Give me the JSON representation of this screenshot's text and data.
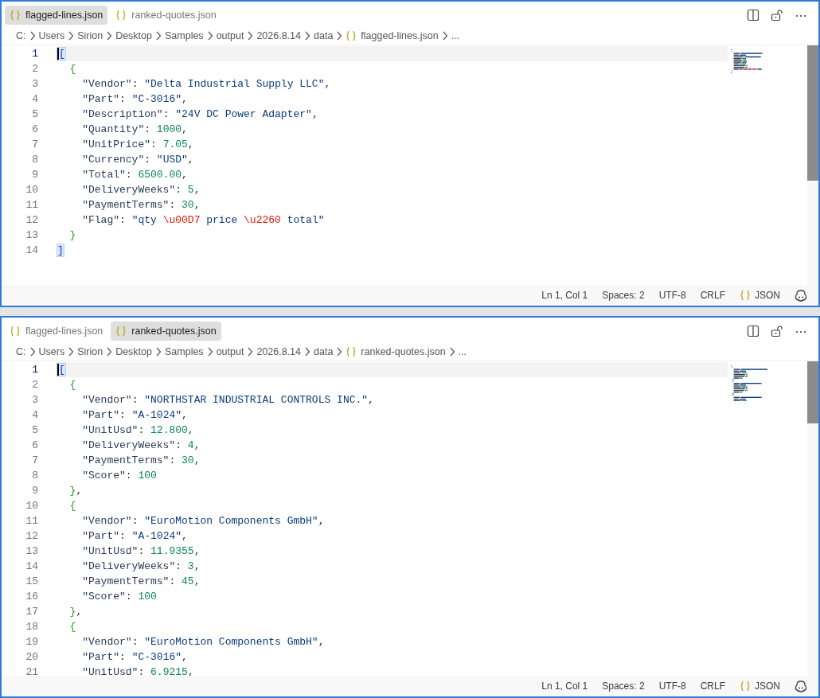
{
  "panes": [
    {
      "tabs": [
        {
          "label": "flagged-lines.json",
          "selected": true
        },
        {
          "label": "ranked-quotes.json",
          "selected": false
        }
      ],
      "breadcrumb": [
        "C:",
        "Users",
        "Sirion",
        "Desktop",
        "Samples",
        "output",
        "2026.8.14",
        "data",
        "flagged-lines.json",
        "..."
      ],
      "lines": [
        {
          "no": "1",
          "current": true,
          "tokens": [
            {
              "kind": "match",
              "text": "["
            }
          ]
        },
        {
          "no": "2",
          "current": false,
          "tokens": [
            {
              "kind": "brace",
              "text": "  {"
            }
          ]
        },
        {
          "no": "3",
          "current": false,
          "tokens": [
            {
              "kind": "key",
              "text": "    \"Vendor\""
            },
            {
              "kind": "p",
              "text": ": "
            },
            {
              "kind": "str",
              "text": "\"Delta Industrial Supply LLC\""
            },
            {
              "kind": "p",
              "text": ","
            }
          ]
        },
        {
          "no": "4",
          "current": false,
          "tokens": [
            {
              "kind": "key",
              "text": "    \"Part\""
            },
            {
              "kind": "p",
              "text": ": "
            },
            {
              "kind": "str",
              "text": "\"C-3016\""
            },
            {
              "kind": "p",
              "text": ","
            }
          ]
        },
        {
          "no": "5",
          "current": false,
          "tokens": [
            {
              "kind": "key",
              "text": "    \"Description\""
            },
            {
              "kind": "p",
              "text": ": "
            },
            {
              "kind": "str",
              "text": "\"24V DC Power Adapter\""
            },
            {
              "kind": "p",
              "text": ","
            }
          ]
        },
        {
          "no": "6",
          "current": false,
          "tokens": [
            {
              "kind": "key",
              "text": "    \"Quantity\""
            },
            {
              "kind": "p",
              "text": ": "
            },
            {
              "kind": "num",
              "text": "1000"
            },
            {
              "kind": "p",
              "text": ","
            }
          ]
        },
        {
          "no": "7",
          "current": false,
          "tokens": [
            {
              "kind": "key",
              "text": "    \"UnitPrice\""
            },
            {
              "kind": "p",
              "text": ": "
            },
            {
              "kind": "num",
              "text": "7.05"
            },
            {
              "kind": "p",
              "text": ","
            }
          ]
        },
        {
          "no": "8",
          "current": false,
          "tokens": [
            {
              "kind": "key",
              "text": "    \"Currency\""
            },
            {
              "kind": "p",
              "text": ": "
            },
            {
              "kind": "str",
              "text": "\"USD\""
            },
            {
              "kind": "p",
              "text": ","
            }
          ]
        },
        {
          "no": "9",
          "current": false,
          "tokens": [
            {
              "kind": "key",
              "text": "    \"Total\""
            },
            {
              "kind": "p",
              "text": ": "
            },
            {
              "kind": "num",
              "text": "6500.00"
            },
            {
              "kind": "p",
              "text": ","
            }
          ]
        },
        {
          "no": "10",
          "current": false,
          "tokens": [
            {
              "kind": "key",
              "text": "    \"DeliveryWeeks\""
            },
            {
              "kind": "p",
              "text": ": "
            },
            {
              "kind": "num",
              "text": "5"
            },
            {
              "kind": "p",
              "text": ","
            }
          ]
        },
        {
          "no": "11",
          "current": false,
          "tokens": [
            {
              "kind": "key",
              "text": "    \"PaymentTerms\""
            },
            {
              "kind": "p",
              "text": ": "
            },
            {
              "kind": "num",
              "text": "30"
            },
            {
              "kind": "p",
              "text": ","
            }
          ]
        },
        {
          "no": "12",
          "current": false,
          "tokens": [
            {
              "kind": "key",
              "text": "    \"Flag\""
            },
            {
              "kind": "p",
              "text": ": "
            },
            {
              "kind": "str",
              "text": "\"qty "
            },
            {
              "kind": "esc",
              "text": "\\u00D7"
            },
            {
              "kind": "str",
              "text": " price "
            },
            {
              "kind": "esc",
              "text": "\\u2260"
            },
            {
              "kind": "str",
              "text": " total\""
            }
          ]
        },
        {
          "no": "13",
          "current": false,
          "tokens": [
            {
              "kind": "brace",
              "text": "  }"
            }
          ]
        },
        {
          "no": "14",
          "current": false,
          "tokens": [
            {
              "kind": "match",
              "text": "]"
            }
          ]
        }
      ],
      "status": [
        "Ln 1, Col 1",
        "Spaces: 2",
        "UTF-8",
        "CRLF",
        "JSON"
      ]
    },
    {
      "tabs": [
        {
          "label": "flagged-lines.json",
          "selected": false
        },
        {
          "label": "ranked-quotes.json",
          "selected": true
        }
      ],
      "breadcrumb": [
        "C:",
        "Users",
        "Sirion",
        "Desktop",
        "Samples",
        "output",
        "2026.8.14",
        "data",
        "ranked-quotes.json",
        "..."
      ],
      "lines": [
        {
          "no": "1",
          "current": true,
          "tokens": [
            {
              "kind": "match",
              "text": "["
            }
          ]
        },
        {
          "no": "2",
          "current": false,
          "tokens": [
            {
              "kind": "brace",
              "text": "  {"
            }
          ]
        },
        {
          "no": "3",
          "current": false,
          "tokens": [
            {
              "kind": "key",
              "text": "    \"Vendor\""
            },
            {
              "kind": "p",
              "text": ": "
            },
            {
              "kind": "str",
              "text": "\"NORTHSTAR INDUSTRIAL CONTROLS INC.\""
            },
            {
              "kind": "p",
              "text": ","
            }
          ]
        },
        {
          "no": "4",
          "current": false,
          "tokens": [
            {
              "kind": "key",
              "text": "    \"Part\""
            },
            {
              "kind": "p",
              "text": ": "
            },
            {
              "kind": "str",
              "text": "\"A-1024\""
            },
            {
              "kind": "p",
              "text": ","
            }
          ]
        },
        {
          "no": "5",
          "current": false,
          "tokens": [
            {
              "kind": "key",
              "text": "    \"UnitUsd\""
            },
            {
              "kind": "p",
              "text": ": "
            },
            {
              "kind": "num",
              "text": "12.800"
            },
            {
              "kind": "p",
              "text": ","
            }
          ]
        },
        {
          "no": "6",
          "current": false,
          "tokens": [
            {
              "kind": "key",
              "text": "    \"DeliveryWeeks\""
            },
            {
              "kind": "p",
              "text": ": "
            },
            {
              "kind": "num",
              "text": "4"
            },
            {
              "kind": "p",
              "text": ","
            }
          ]
        },
        {
          "no": "7",
          "current": false,
          "tokens": [
            {
              "kind": "key",
              "text": "    \"PaymentTerms\""
            },
            {
              "kind": "p",
              "text": ": "
            },
            {
              "kind": "num",
              "text": "30"
            },
            {
              "kind": "p",
              "text": ","
            }
          ]
        },
        {
          "no": "8",
          "current": false,
          "tokens": [
            {
              "kind": "key",
              "text": "    \"Score\""
            },
            {
              "kind": "p",
              "text": ": "
            },
            {
              "kind": "num",
              "text": "100"
            }
          ]
        },
        {
          "no": "9",
          "current": false,
          "tokens": [
            {
              "kind": "brace",
              "text": "  }"
            },
            {
              "kind": "p",
              "text": ","
            }
          ]
        },
        {
          "no": "10",
          "current": false,
          "tokens": [
            {
              "kind": "brace",
              "text": "  {"
            }
          ]
        },
        {
          "no": "11",
          "current": false,
          "tokens": [
            {
              "kind": "key",
              "text": "    \"Vendor\""
            },
            {
              "kind": "p",
              "text": ": "
            },
            {
              "kind": "str",
              "text": "\"EuroMotion Components GmbH\""
            },
            {
              "kind": "p",
              "text": ","
            }
          ]
        },
        {
          "no": "12",
          "current": false,
          "tokens": [
            {
              "kind": "key",
              "text": "    \"Part\""
            },
            {
              "kind": "p",
              "text": ": "
            },
            {
              "kind": "str",
              "text": "\"A-1024\""
            },
            {
              "kind": "p",
              "text": ","
            }
          ]
        },
        {
          "no": "13",
          "current": false,
          "tokens": [
            {
              "kind": "key",
              "text": "    \"UnitUsd\""
            },
            {
              "kind": "p",
              "text": ": "
            },
            {
              "kind": "num",
              "text": "11.9355"
            },
            {
              "kind": "p",
              "text": ","
            }
          ]
        },
        {
          "no": "14",
          "current": false,
          "tokens": [
            {
              "kind": "key",
              "text": "    \"DeliveryWeeks\""
            },
            {
              "kind": "p",
              "text": ": "
            },
            {
              "kind": "num",
              "text": "3"
            },
            {
              "kind": "p",
              "text": ","
            }
          ]
        },
        {
          "no": "15",
          "current": false,
          "tokens": [
            {
              "kind": "key",
              "text": "    \"PaymentTerms\""
            },
            {
              "kind": "p",
              "text": ": "
            },
            {
              "kind": "num",
              "text": "45"
            },
            {
              "kind": "p",
              "text": ","
            }
          ]
        },
        {
          "no": "16",
          "current": false,
          "tokens": [
            {
              "kind": "key",
              "text": "    \"Score\""
            },
            {
              "kind": "p",
              "text": ": "
            },
            {
              "kind": "num",
              "text": "100"
            }
          ]
        },
        {
          "no": "17",
          "current": false,
          "tokens": [
            {
              "kind": "brace",
              "text": "  }"
            },
            {
              "kind": "p",
              "text": ","
            }
          ]
        },
        {
          "no": "18",
          "current": false,
          "tokens": [
            {
              "kind": "brace",
              "text": "  {"
            }
          ]
        },
        {
          "no": "19",
          "current": false,
          "tokens": [
            {
              "kind": "key",
              "text": "    \"Vendor\""
            },
            {
              "kind": "p",
              "text": ": "
            },
            {
              "kind": "str",
              "text": "\"EuroMotion Components GmbH\""
            },
            {
              "kind": "p",
              "text": ","
            }
          ]
        },
        {
          "no": "20",
          "current": false,
          "tokens": [
            {
              "kind": "key",
              "text": "    \"Part\""
            },
            {
              "kind": "p",
              "text": ": "
            },
            {
              "kind": "str",
              "text": "\"C-3016\""
            },
            {
              "kind": "p",
              "text": ","
            }
          ]
        },
        {
          "no": "21",
          "current": false,
          "tokens": [
            {
              "kind": "key",
              "text": "    \"UnitUsd\""
            },
            {
              "kind": "p",
              "text": ": "
            },
            {
              "kind": "num",
              "text": "6.9215"
            },
            {
              "kind": "p",
              "text": ","
            }
          ]
        }
      ],
      "status": [
        "Ln 1, Col 1",
        "Spaces: 2",
        "UTF-8",
        "CRLF",
        "JSON"
      ]
    }
  ]
}
